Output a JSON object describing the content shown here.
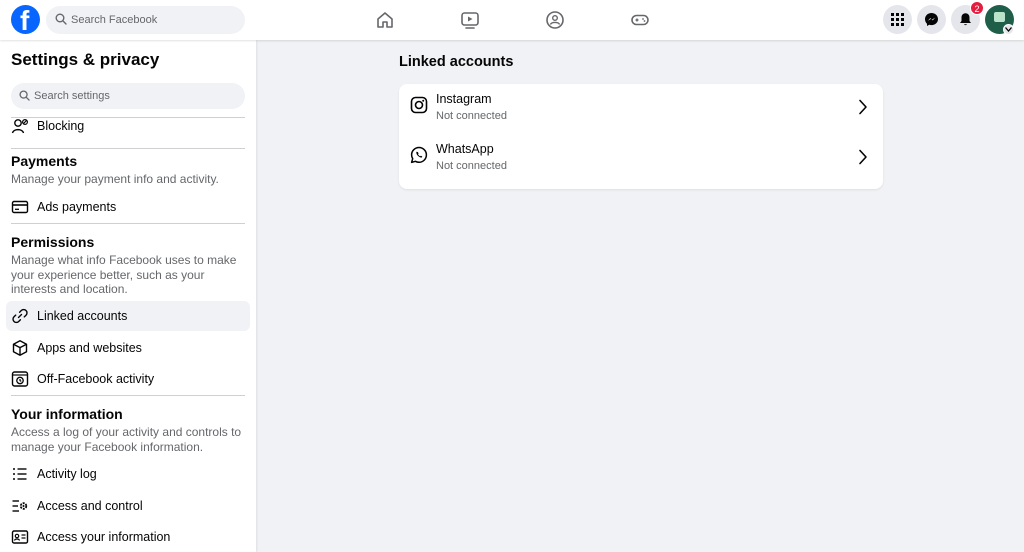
{
  "topbar": {
    "logo_letter": "f",
    "search_placeholder": "Search Facebook",
    "nav_icons": [
      "home-icon",
      "watch-icon",
      "groups-icon",
      "gaming-icon"
    ],
    "right_icons": [
      "menu-grid-icon",
      "messenger-icon",
      "notifications-icon"
    ],
    "notification_count": "2"
  },
  "sidebar": {
    "title": "Settings & privacy",
    "search_placeholder": "Search settings",
    "blocking_label": "Blocking",
    "payments": {
      "title": "Payments",
      "description": "Manage your payment info and activity.",
      "items": [
        {
          "label": "Ads payments",
          "icon": "credit-card-icon"
        }
      ]
    },
    "permissions": {
      "title": "Permissions",
      "description": "Manage what info Facebook uses to make your experience better, such as your interests and location.",
      "items": [
        {
          "label": "Linked accounts",
          "icon": "link-icon",
          "active": true
        },
        {
          "label": "Apps and websites",
          "icon": "cube-icon"
        },
        {
          "label": "Off-Facebook activity",
          "icon": "history-icon"
        }
      ]
    },
    "your_information": {
      "title": "Your information",
      "description": "Access a log of your activity and controls to manage your Facebook information.",
      "items": [
        {
          "label": "Activity log",
          "icon": "list-icon"
        },
        {
          "label": "Access and control",
          "icon": "settings-list-icon"
        },
        {
          "label": "Access your information",
          "icon": "id-card-icon"
        }
      ]
    }
  },
  "main": {
    "title": "Linked accounts",
    "accounts": [
      {
        "name": "Instagram",
        "status": "Not connected",
        "icon": "instagram-icon"
      },
      {
        "name": "WhatsApp",
        "status": "Not connected",
        "icon": "whatsapp-icon"
      }
    ]
  },
  "colors": {
    "brand": "#0866ff",
    "page_bg": "#f0f2f5",
    "badge": "#e41e3f",
    "secondary_text": "#65676b"
  }
}
